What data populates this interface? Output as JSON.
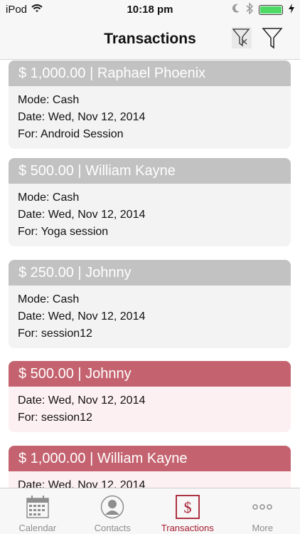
{
  "status": {
    "carrier": "iPod",
    "time": "10:18 pm",
    "battery_level": 1.0,
    "icons": [
      "wifi-icon",
      "moon-icon",
      "bluetooth-icon",
      "battery-icon",
      "charging-bolt-icon"
    ]
  },
  "header": {
    "title": "Transactions",
    "buttons": [
      "clear-filter-icon",
      "filter-icon"
    ]
  },
  "transactions": [
    {
      "heading": "$ 1,000.00 | Raphael Phoenix",
      "mode": "Mode: Cash",
      "date": "Date: Wed, Nov 12, 2014",
      "for": "For: Android Session",
      "style": "grey"
    },
    {
      "heading": "$ 500.00 | William Kayne",
      "mode": "Mode: Cash",
      "date": "Date: Wed, Nov 12, 2014",
      "for": "For: Yoga session",
      "style": "grey"
    },
    {
      "heading": "$ 250.00 | Johnny",
      "mode": "Mode: Cash",
      "date": "Date: Wed, Nov 12, 2014",
      "for": "For: session12",
      "style": "grey"
    },
    {
      "heading": "$ 500.00 | Johnny",
      "date": "Date: Wed, Nov 12, 2014",
      "for": "For: session12",
      "style": "red"
    },
    {
      "heading": "$ 1,000.00 | William Kayne",
      "date": "Date: Wed, Nov 12, 2014",
      "style": "red"
    }
  ],
  "tabs": [
    {
      "label": "Calendar",
      "icon": "calendar-icon"
    },
    {
      "label": "Contacts",
      "icon": "contacts-icon"
    },
    {
      "label": "Transactions",
      "icon": "dollar-icon",
      "active": true
    },
    {
      "label": "More",
      "icon": "more-icon"
    }
  ],
  "colors": {
    "accent": "#a51d30",
    "card_grey_header": "#c2c2c2",
    "card_red_header": "#c4636f",
    "card_red_body": "#fdf0f2"
  }
}
